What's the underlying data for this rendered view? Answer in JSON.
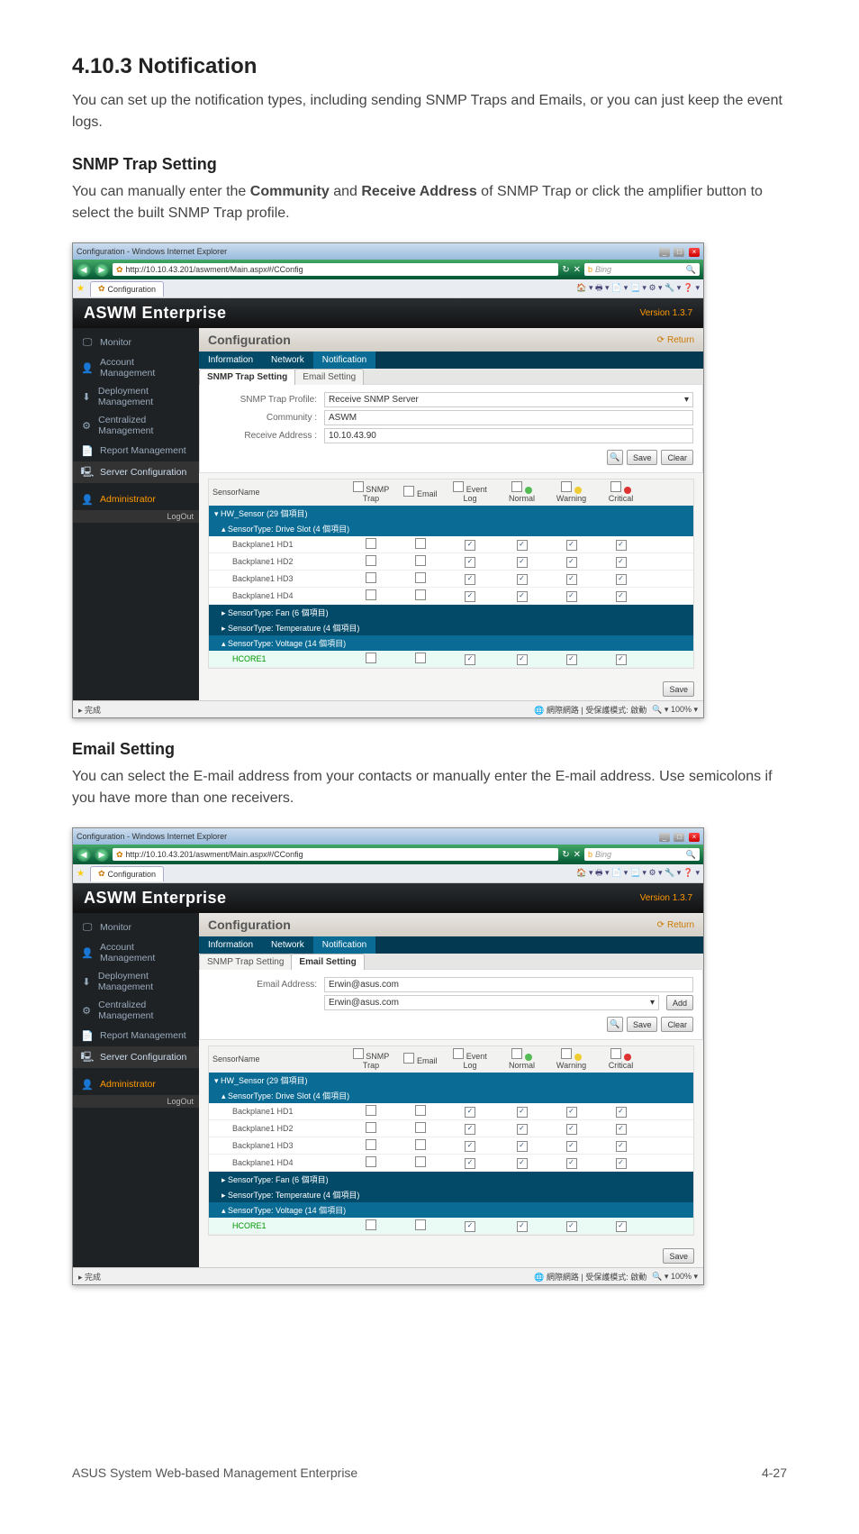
{
  "section": {
    "number_title": "4.10.3    Notification",
    "intro": "You can set up the notification types, including sending SNMP Traps and Emails, or you can just keep the event logs.",
    "snmp_heading": "SNMP Trap Setting",
    "snmp_text_pre": "You can manually enter the ",
    "snmp_bold1": "Community",
    "snmp_mid": " and ",
    "snmp_bold2": "Receive Address",
    "snmp_text_post": " of SNMP Trap or click the amplifier button to select the built SNMP Trap profile.",
    "email_heading": "Email Setting",
    "email_text": "You can select the E-mail address from your contacts or manually enter the E-mail address. Use semicolons if you have more than one receivers."
  },
  "footer": {
    "left": "ASUS System Web-based Management Enterprise",
    "right": "4-27"
  },
  "window": {
    "ie_title": "Configuration - Windows Internet Explorer",
    "url": "http://10.10.43.201/aswment/Main.aspx#/CConfig",
    "search_placeholder": "Bing",
    "tab_label": "Configuration",
    "toolbar_icons": "🏠 ▾ 🖶 ▾ 📄 ▾ 📃 ▾ ⚙ ▾ 🔧 ▾ ❓ ▾",
    "brand": "ASWM Enterprise",
    "version": "Version 1.3.7",
    "status_done": "完成",
    "status_zone": "網際網路 | 受保護模式: 啟動",
    "status_zoom": "100%"
  },
  "sidebar": {
    "items": [
      {
        "label": "Monitor",
        "icon": "🖵"
      },
      {
        "label": "Account Management",
        "icon": "👤"
      },
      {
        "label": "Deployment Management",
        "icon": "⬇"
      },
      {
        "label": "Centralized Management",
        "icon": "⚙"
      },
      {
        "label": "Report Management",
        "icon": "📄"
      },
      {
        "label": "Server Configuration",
        "icon": "🖳"
      }
    ],
    "admin": "Administrator",
    "logout": "LogOut"
  },
  "content": {
    "title": "Configuration",
    "return": "Return",
    "tabs": [
      "Information",
      "Network",
      "Notification"
    ],
    "subtabs": [
      "SNMP Trap Setting",
      "Email Setting"
    ],
    "snmp_form": {
      "profile_label": "SNMP Trap Profile:",
      "profile_value": "Receive SNMP Server",
      "community_label": "Community :",
      "community_value": "ASWM",
      "address_label": "Receive Address :",
      "address_value": "10.10.43.90",
      "save": "Save",
      "clear": "Clear"
    },
    "email_form": {
      "address_label": "Email Address:",
      "address_value": "Erwin@asus.com",
      "list_value": "Erwin@asus.com",
      "add": "Add",
      "save": "Save",
      "clear": "Clear"
    },
    "sensor_headers": {
      "name": "SensorName",
      "snmp": "SNMP Trap",
      "email": "Email",
      "log": "Event Log",
      "normal": "Normal",
      "warning": "Warning",
      "critical": "Critical"
    },
    "sensor_groups": {
      "hw": "HW_Sensor (29 個項目)",
      "drive": "SensorType: Drive Slot (4 個項目)",
      "fan": "SensorType: Fan (6 個項目)",
      "temp": "SensorType: Temperature (4 個項目)",
      "volt": "SensorType: Voltage (14 個項目)",
      "cores": "HCORE1"
    },
    "sensor_rows": [
      {
        "name": "Backplane1 HD1"
      },
      {
        "name": "Backplane1 HD2"
      },
      {
        "name": "Backplane1 HD3"
      },
      {
        "name": "Backplane1 HD4"
      }
    ],
    "save_btn": "Save"
  }
}
